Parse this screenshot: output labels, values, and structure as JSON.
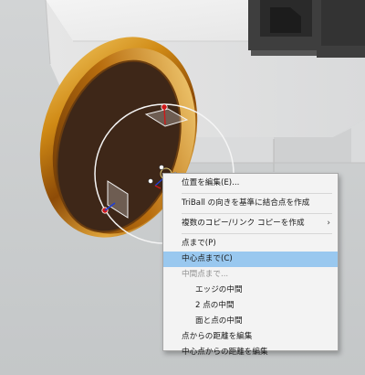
{
  "scene": {
    "icons": [
      "cad-viewport",
      "triball-icon",
      "cursor-icon"
    ]
  },
  "context_menu": {
    "items": [
      {
        "label": "位置を編集(E)..."
      },
      {
        "label": "TriBall の向きを基準に結合点を作成"
      },
      {
        "label": "複数のコピー/リンク コピーを作成",
        "submenu_arrow": "›"
      },
      {
        "label": "点まで(P)"
      },
      {
        "label": "中心点まで(C)",
        "state": "highlighted"
      },
      {
        "label": "中間点まで...",
        "state": "disabled"
      },
      {
        "label": "エッジの中間"
      },
      {
        "label": "2 点の中間"
      },
      {
        "label": "面と点の中間"
      },
      {
        "label": "点からの距離を編集"
      },
      {
        "label": "中心点からの距離を編集"
      }
    ]
  },
  "colors": {
    "viewport_bg": "#c9cccd",
    "menu_bg": "#f3f3f3",
    "menu_highlight": "#99c8ef",
    "disc_face": "#3e2718",
    "gold_rim": "#c98a19"
  }
}
